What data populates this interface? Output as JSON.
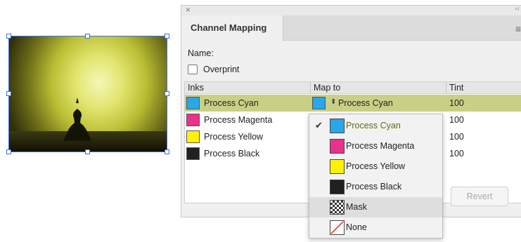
{
  "panel": {
    "close_icon": "×",
    "collapse_icon": "‹‹",
    "tab_label": "Channel Mapping",
    "menu_icon": "≡",
    "name_label": "Name:",
    "overprint_label": "Overprint",
    "columns": {
      "inks": "Inks",
      "map_to": "Map to",
      "tint": "Tint"
    },
    "rows": [
      {
        "ink": "Process Cyan",
        "ink_color": "#2aa7e8",
        "map_to": "Process Cyan",
        "map_color": "#2aa7e8",
        "tint": "100"
      },
      {
        "ink": "Process Magenta",
        "ink_color": "#e8328a",
        "tint": "100"
      },
      {
        "ink": "Process Yellow",
        "ink_color": "#fff200",
        "tint": "100"
      },
      {
        "ink": "Process Black",
        "ink_color": "#231f20",
        "tint": "100"
      }
    ],
    "revert_label": "Revert"
  },
  "dropdown": {
    "items": [
      {
        "label": "Process Cyan",
        "color": "#2aa7e8",
        "checked": true
      },
      {
        "label": "Process Magenta",
        "color": "#e8328a"
      },
      {
        "label": "Process Yellow",
        "color": "#fff200"
      },
      {
        "label": "Process Black",
        "color": "#231f20"
      },
      {
        "label": "Mask",
        "icon": "checker-swatch-icon"
      },
      {
        "label": "None",
        "icon": "none-swatch-icon"
      }
    ],
    "check_icon": "✔"
  },
  "colors": {
    "accent_row": "#c9d085",
    "selection": "#3f6fd8",
    "checked_text": "#5b6b12"
  }
}
